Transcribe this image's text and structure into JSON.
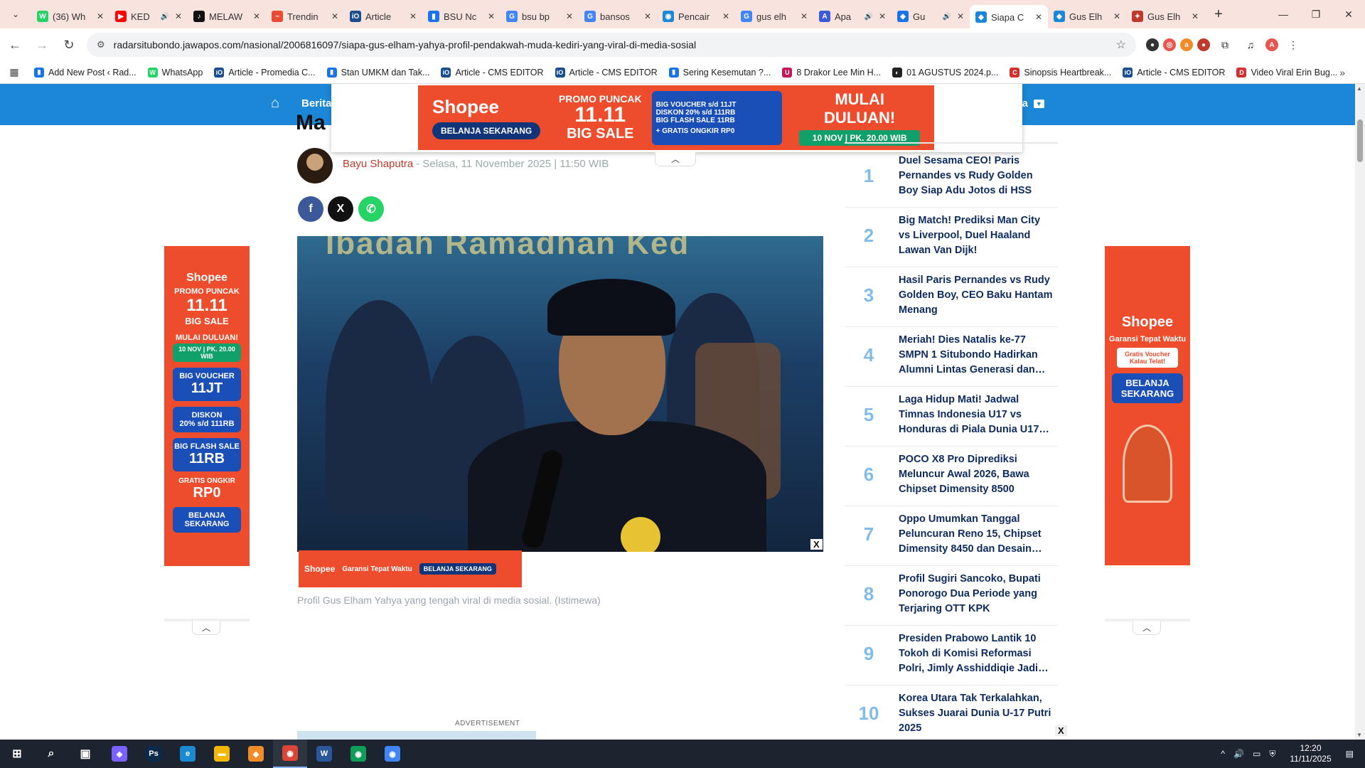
{
  "browser": {
    "tabs": [
      {
        "title": "(36) Wh",
        "color": "#25d366",
        "glyph": "W",
        "audio": false
      },
      {
        "title": "KED",
        "color": "#ff0000",
        "glyph": "▶",
        "audio": true
      },
      {
        "title": "MELAW",
        "color": "#111111",
        "glyph": "♪",
        "audio": false
      },
      {
        "title": "Trendin",
        "color": "#e94b35",
        "glyph": "~",
        "audio": false
      },
      {
        "title": "Article",
        "color": "#1a4d8f",
        "glyph": "iO",
        "audio": false
      },
      {
        "title": "BSU Nc",
        "color": "#1a73e8",
        "glyph": "▮",
        "audio": false
      },
      {
        "title": "bsu bp",
        "color": "#4285f4",
        "glyph": "G",
        "audio": false
      },
      {
        "title": "bansos",
        "color": "#4285f4",
        "glyph": "G",
        "audio": false
      },
      {
        "title": "Pencair",
        "color": "#1c87d6",
        "glyph": "◉",
        "audio": false
      },
      {
        "title": "gus elh",
        "color": "#4285f4",
        "glyph": "G",
        "audio": false
      },
      {
        "title": "Apa",
        "color": "#3b5bdb",
        "glyph": "A",
        "audio": true
      },
      {
        "title": "Gu",
        "color": "#1a73e8",
        "glyph": "◆",
        "audio": true
      },
      {
        "title": "Siapa C",
        "color": "#1c87d6",
        "glyph": "◆",
        "audio": false
      },
      {
        "title": "Gus Elh",
        "color": "#1c87d6",
        "glyph": "◆",
        "audio": false
      },
      {
        "title": "Gus Elh",
        "color": "#c0392b",
        "glyph": "✦",
        "audio": false
      }
    ],
    "active_tab_index": 12,
    "url": "radarsitubondo.jawapos.com/nasional/2006816097/siapa-gus-elham-yahya-profil-pendakwah-muda-kediri-yang-viral-di-media-sosial",
    "profile_initial": "A",
    "bookmarks": [
      {
        "label": "Add New Post ‹ Rad...",
        "color": "#1a73e8",
        "glyph": "▮"
      },
      {
        "label": "WhatsApp",
        "color": "#25d366",
        "glyph": "W"
      },
      {
        "label": "Article - Promedia C...",
        "color": "#1a4d8f",
        "glyph": "iO"
      },
      {
        "label": "Stan UMKM dan Tak...",
        "color": "#1a73e8",
        "glyph": "▮"
      },
      {
        "label": "Article - CMS EDITOR",
        "color": "#1a4d8f",
        "glyph": "iO"
      },
      {
        "label": "Article - CMS EDITOR",
        "color": "#1a4d8f",
        "glyph": "iO"
      },
      {
        "label": "Sering Kesemutan ?...",
        "color": "#1a73e8",
        "glyph": "▮"
      },
      {
        "label": "8 Drakor Lee Min H...",
        "color": "#c2185b",
        "glyph": "U"
      },
      {
        "label": "01 AGUSTUS 2024.p...",
        "color": "#222222",
        "glyph": "◐"
      },
      {
        "label": "Sinopsis Heartbreak...",
        "color": "#d32f2f",
        "glyph": "C"
      },
      {
        "label": "Article - CMS EDITOR",
        "color": "#1a4d8f",
        "glyph": "iO"
      },
      {
        "label": "Video Viral Erin Bug...",
        "color": "#d32f2f",
        "glyph": "D"
      }
    ]
  },
  "site": {
    "nav_menu_left": "Berita",
    "nav_menu_right": "hya",
    "title_fragment": "Ma",
    "author": "Bayu Shaputra",
    "date": "- Selasa, 11 November 2025 | 11:50 WIB",
    "share": {
      "facebook": "f",
      "x": "X",
      "whatsapp": "✆"
    },
    "caption": "Profil Gus Elham Yahya yang tengah viral di media sosial. (Istimewa)",
    "hero_banner_text": "Ibadah Ramadhan Ked",
    "advertisement_label": "ADVERTISEMENT",
    "close_label": "X"
  },
  "ads": {
    "top": {
      "brand": "Shopee",
      "cta": "BELANJA SEKARANG",
      "promo_line1": "PROMO PUNCAK",
      "promo_line2": "11.11",
      "promo_line3": "BIG SALE",
      "box_line1": "BIG VOUCHER s/d 11JT",
      "box_line2": "DISKON 20% s/d 111RB",
      "box_line3": "BIG FLASH SALE 11RB",
      "box_free": "+ GRATIS ONGKIR RP0",
      "cta2_line1": "MULAI DULUAN!",
      "cta2_line2": "10 NOV | PK. 20.00 WIB"
    },
    "left": {
      "brand": "Shopee",
      "promo1": "PROMO PUNCAK",
      "promo2": "11.11",
      "promo3": "BIG SALE",
      "start": "MULAI DULUAN!",
      "start_time": "10 NOV | PK. 20.00 WIB",
      "voucher_a": "BIG VOUCHER",
      "voucher_b": "11JT",
      "diskon_a": "DISKON",
      "diskon_b": "20% s/d 111RB",
      "flash_a": "BIG FLASH SALE",
      "flash_b": "11RB",
      "free_a": "GRATIS ONGKIR",
      "free_b": "RP0",
      "cta": "BELANJA SEKARANG"
    },
    "right": {
      "brand": "Shopee",
      "garansi": "Garansi Tepat Waktu",
      "voucher": "Gratis Voucher Kalau Telat!",
      "cta": "BELANJA SEKARANG"
    },
    "sticky": {
      "brand": "Shopee",
      "garansi": "Garansi Tepat Waktu",
      "cta": "BELANJA SEKARANG"
    }
  },
  "trending": [
    {
      "rank": "1",
      "title": "Duel Sesama CEO! Paris Pernandes vs Rudy Golden Boy Siap Adu Jotos di HSS"
    },
    {
      "rank": "2",
      "title": "Big Match! Prediksi Man City vs Liverpool, Duel Haaland Lawan Van Dijk!"
    },
    {
      "rank": "3",
      "title": "Hasil Paris Pernandes vs Rudy Golden Boy, CEO Baku Hantam Menang"
    },
    {
      "rank": "4",
      "title": "Meriah! Dies Natalis ke-77 SMPN 1 Situbondo Hadirkan Alumni Lintas Generasi dan…"
    },
    {
      "rank": "5",
      "title": "Laga Hidup Mati! Jadwal Timnas Indonesia U17 vs Honduras di Piala Dunia U17…"
    },
    {
      "rank": "6",
      "title": "POCO X8 Pro Diprediksi Meluncur Awal 2026, Bawa Chipset Dimensity 8500"
    },
    {
      "rank": "7",
      "title": "Oppo Umumkan Tanggal Peluncuran Reno 15, Chipset Dimensity 8450 dan Desain…"
    },
    {
      "rank": "8",
      "title": "Profil Sugiri Sancoko, Bupati Ponorogo Dua Periode yang Terjaring OTT KPK"
    },
    {
      "rank": "9",
      "title": "Presiden Prabowo Lantik 10 Tokoh di Komisi Reformasi Polri, Jimly Asshiddiqie Jadi…"
    },
    {
      "rank": "10",
      "title": "Korea Utara Tak Terkalahkan, Sukses Juarai Dunia U-17 Putri 2025"
    }
  ],
  "taskbar": {
    "apps": [
      {
        "name": "start",
        "glyph": "⊞",
        "color": "transparent"
      },
      {
        "name": "search",
        "glyph": "⌕",
        "color": "transparent"
      },
      {
        "name": "task-view",
        "glyph": "▣",
        "color": "transparent"
      },
      {
        "name": "copilot",
        "glyph": "◈",
        "color": "#7b61ff"
      },
      {
        "name": "photoshop",
        "glyph": "Ps",
        "color": "#0b2a4a"
      },
      {
        "name": "edge",
        "glyph": "e",
        "color": "#1b8ad1"
      },
      {
        "name": "file-explorer",
        "glyph": "▬",
        "color": "#f2b705"
      },
      {
        "name": "app-orange",
        "glyph": "◆",
        "color": "#f28c28"
      },
      {
        "name": "chrome-profile",
        "glyph": "◉",
        "color": "#db4437"
      },
      {
        "name": "word",
        "glyph": "W",
        "color": "#2b579a"
      },
      {
        "name": "chrome",
        "glyph": "◉",
        "color": "#0f9d58"
      },
      {
        "name": "chrome-2",
        "glyph": "◉",
        "color": "#4285f4"
      }
    ],
    "active_index": 8,
    "time": "12:20",
    "date": "11/11/2025"
  }
}
